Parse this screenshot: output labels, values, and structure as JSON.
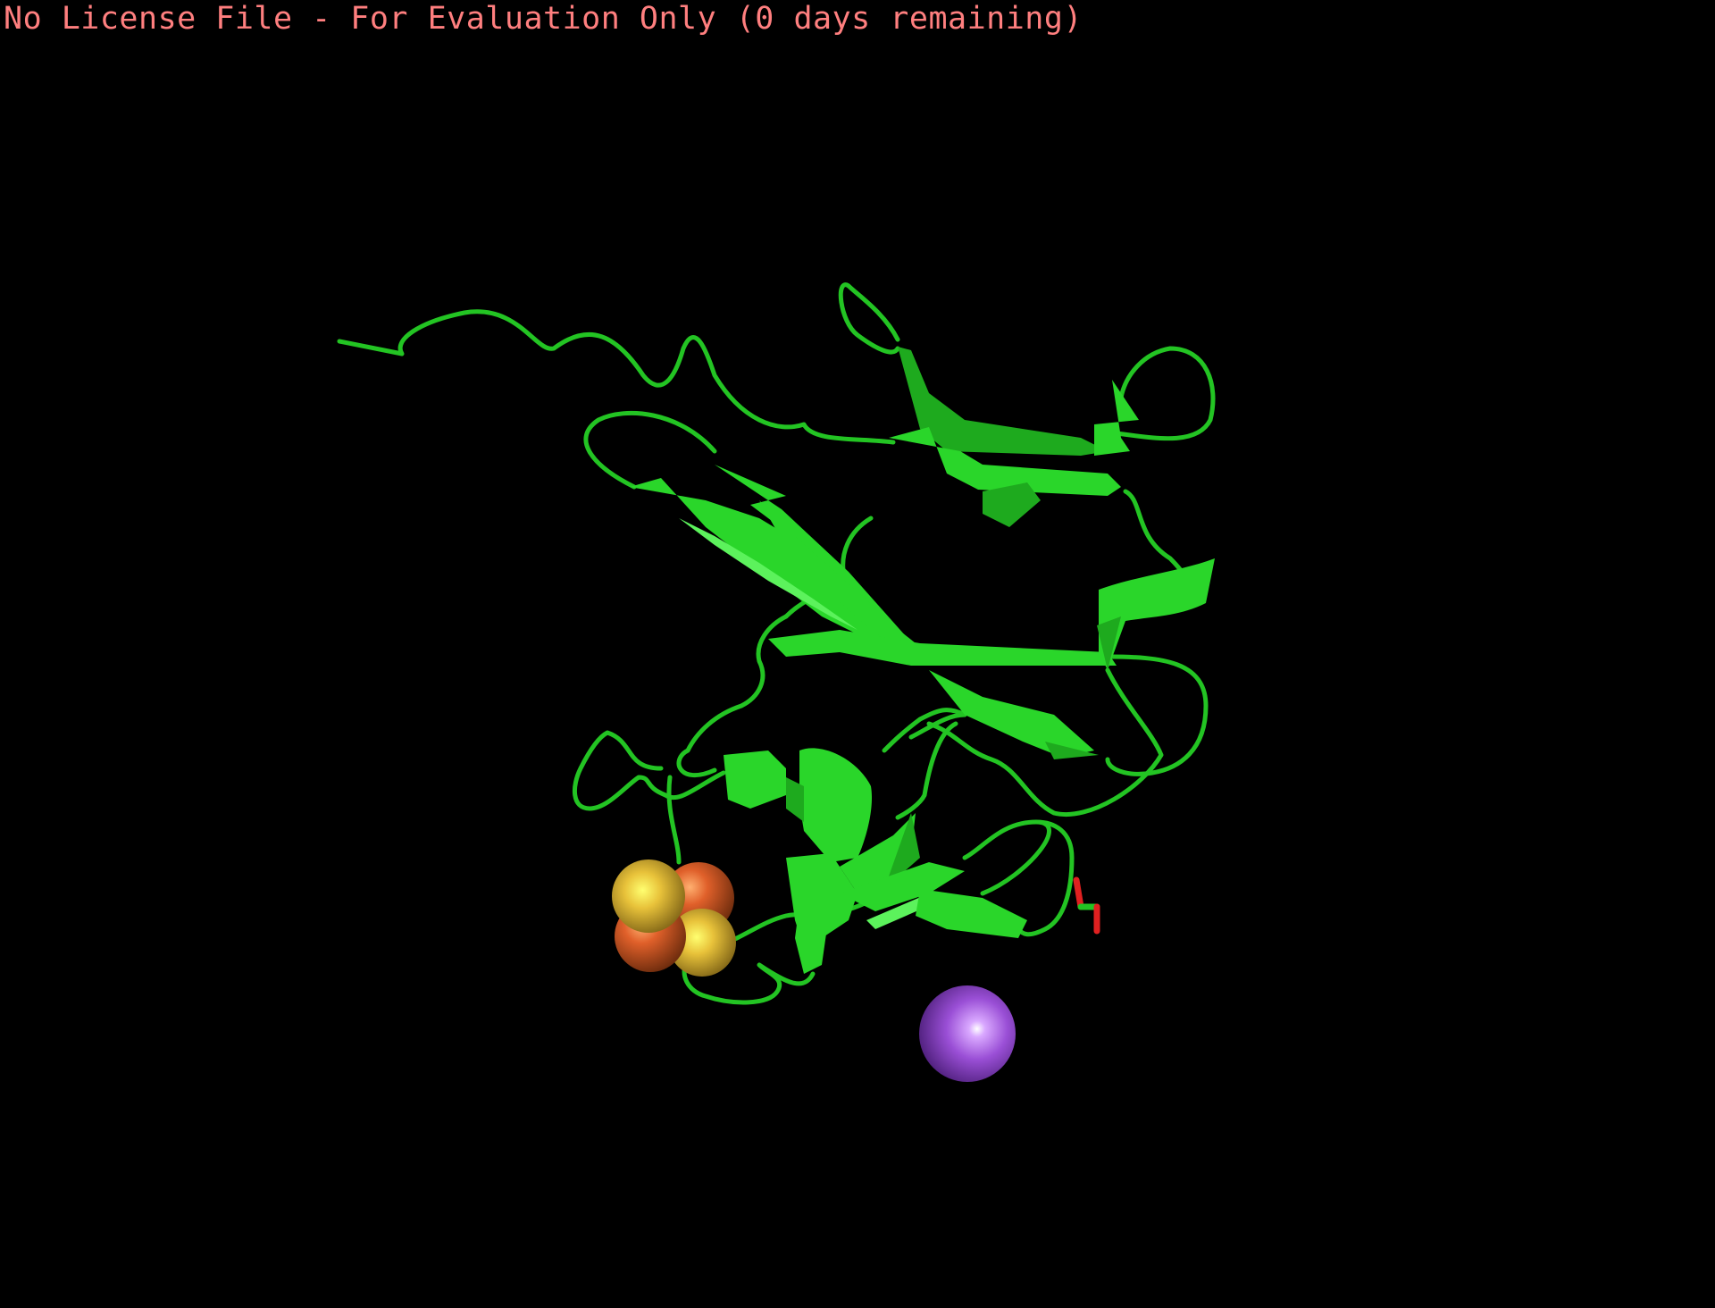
{
  "app": {
    "license_banner": "No License File - For Evaluation Only (0 days remaining)"
  },
  "colors": {
    "background": "#000000",
    "banner_text": "#ff7f7f",
    "protein_cartoon": "#23c423",
    "iron_atoms": "#e0602a",
    "sulfur_atoms": "#e8c23a",
    "ion_sphere": "#9a4fd6",
    "ligand_oxygen": "#e02020"
  }
}
